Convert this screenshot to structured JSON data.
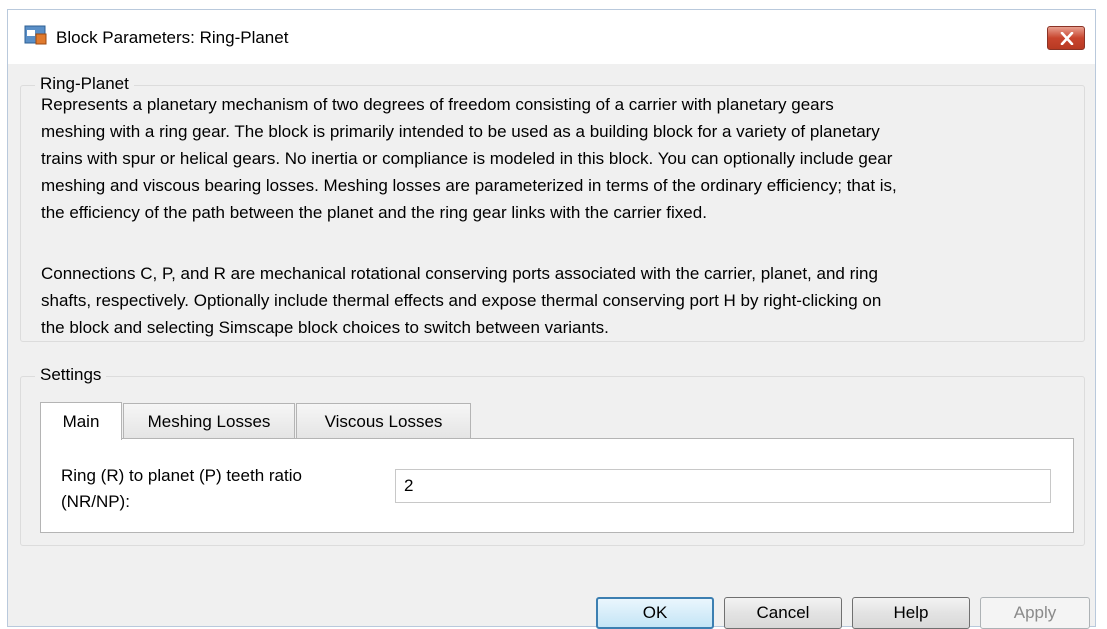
{
  "window": {
    "title": "Block Parameters: Ring-Planet"
  },
  "description": {
    "group_label": "Ring-Planet",
    "lines": [
      "Represents a planetary mechanism of two degrees of freedom consisting of a carrier with planetary gears",
      "meshing with a ring gear. The block is primarily intended to be used as a building block for a variety of planetary",
      "trains with spur or helical gears. No inertia or compliance is modeled in this block. You can optionally include gear",
      "meshing and viscous bearing losses. Meshing losses are parameterized in terms of the ordinary efficiency; that is,",
      "the efficiency of the path between the planet and the ring gear links with the carrier fixed.",
      "Connections C, P, and R are mechanical rotational conserving ports associated with the carrier, planet, and ring",
      "shafts, respectively. Optionally include thermal effects and expose thermal conserving port H by right-clicking on",
      "the block and selecting Simscape block choices to switch between variants."
    ]
  },
  "settings": {
    "group_label": "Settings",
    "tabs": [
      {
        "label": "Main",
        "active": true
      },
      {
        "label": "Meshing Losses",
        "active": false
      },
      {
        "label": "Viscous Losses",
        "active": false
      }
    ],
    "param": {
      "label_line1": "Ring (R) to planet (P) teeth ratio",
      "label_line2": "(NR/NP):",
      "value": "2"
    }
  },
  "buttons": {
    "ok": "OK",
    "cancel": "Cancel",
    "help": "Help",
    "apply": "Apply"
  },
  "icons": {
    "app": "block-parameters-icon",
    "close": "close-icon"
  },
  "colors": {
    "dialog_bg": "#f0f0f0",
    "close_red": "#c8452e",
    "default_button_border": "#3c7fb1"
  }
}
